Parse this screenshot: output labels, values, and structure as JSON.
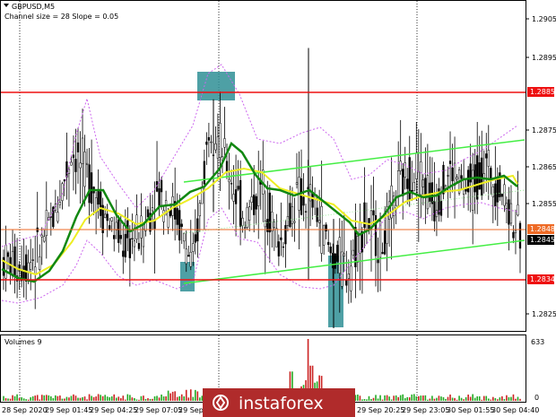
{
  "header": {
    "symbol_label": "GBPUSD,M5",
    "indicator_label": "Channel size = 28 Slope = 0.05"
  },
  "price_axis": {
    "ticks": [
      "1.2905",
      "1.2895",
      "1.2875",
      "1.2865",
      "1.2855",
      "1.2845",
      "1.2825"
    ],
    "range": [
      1.2818,
      1.2913
    ]
  },
  "price_tags": [
    {
      "value": "1.2885",
      "color": "#ee1111"
    },
    {
      "value": "1.2848",
      "color": "#ee6a25"
    },
    {
      "value": "1.2845",
      "color": "#000000"
    },
    {
      "value": "1.2834",
      "color": "#ee1111"
    }
  ],
  "volume_panel": {
    "title": "Volumes 9",
    "axis_ticks": [
      "633",
      "0"
    ]
  },
  "time_axis": {
    "labels": [
      "28 Sep 2020",
      "29 Sep 01:45",
      "29 Sep 04:25",
      "29 Sep 07:05",
      "29 Sep 1",
      "29 Sep 20:25",
      "29 Sep 23:05",
      "30 Sep 01:55",
      "30 Sep 04:40"
    ]
  },
  "watermark": {
    "text": "instaforex"
  },
  "colors": {
    "support_resistance": "#ee1111",
    "current_price_line": "#ee6a25",
    "channel": "#44ee44",
    "ma_fast": "#118811",
    "ma_slow": "#eeee22",
    "bands": "#cc66ee",
    "highlight": "#2f8f95",
    "volume_up": "#22aa22",
    "volume_down": "#cc2222",
    "watermark_bg": "#b02b2b"
  },
  "chart_data": {
    "type": "candlestick",
    "title": "GBPUSD,M5",
    "ylim": [
      1.2818,
      1.2913
    ],
    "levels": [
      1.2885,
      1.2848,
      1.2845,
      1.2834
    ],
    "volume_max": 633,
    "series": [
      {
        "name": "price",
        "values": [
          1.2838,
          1.2836,
          1.284,
          1.2852,
          1.287,
          1.2862,
          1.285,
          1.2842,
          1.2846,
          1.2858,
          1.2852,
          1.2835,
          1.288,
          1.2865,
          1.285,
          1.286,
          1.2842,
          1.2856,
          1.2855,
          1.284,
          1.2835,
          1.285,
          1.2842,
          1.286,
          1.2865,
          1.2855,
          1.2864,
          1.2858,
          1.2866,
          1.2858,
          1.2845
        ]
      }
    ]
  }
}
